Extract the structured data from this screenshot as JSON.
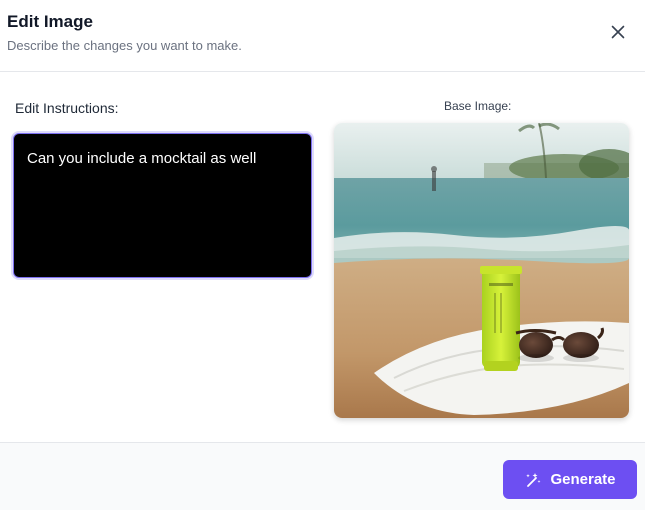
{
  "dialog": {
    "title": "Edit Image",
    "subtitle": "Describe the changes you want to make.",
    "close_icon": "close-icon"
  },
  "form": {
    "instructions_label": "Edit Instructions:",
    "instructions_value": "Can you include a mocktail as well",
    "base_image_label": "Base Image:"
  },
  "footer": {
    "generate_label": "Generate",
    "generate_icon": "magic-wand-icon"
  },
  "colors": {
    "accent": "#6d4ff2",
    "textarea_border": "#7c6ff0"
  }
}
